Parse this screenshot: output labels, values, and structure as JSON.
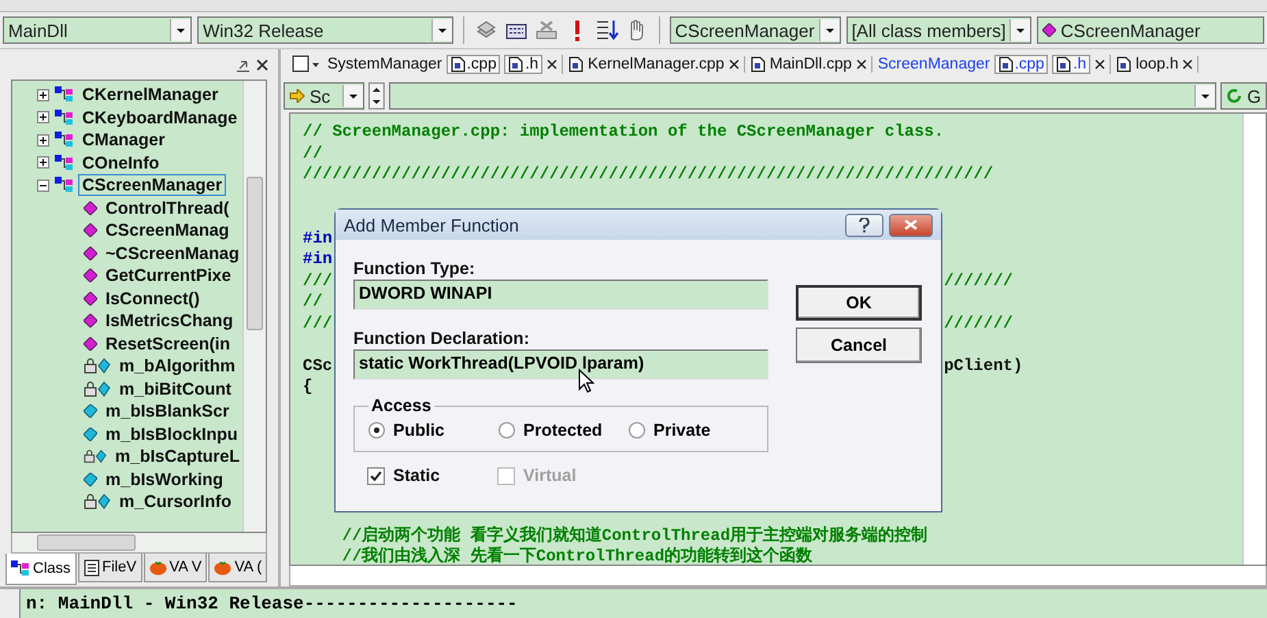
{
  "toolbar": {
    "project": "MainDll",
    "configuration": "Win32 Release",
    "class_combo": "CScreenManager",
    "filter_combo": "[All class members]",
    "member_combo": "CScreenManager"
  },
  "editor_tabs": [
    {
      "label": "SystemManager",
      "files": [
        ".cpp",
        ".h"
      ],
      "selected": false
    },
    {
      "label": "KernelManager.cpp",
      "selected": false
    },
    {
      "label": "MainDll.cpp",
      "selected": false
    },
    {
      "label": "ScreenManager",
      "files": [
        ".cpp",
        ".h"
      ],
      "selected": true
    },
    {
      "label": "loop.h",
      "selected": false
    }
  ],
  "wizard_bar": {
    "scope": "Sc",
    "go": "G"
  },
  "class_tree": [
    {
      "label": "CKernelManager",
      "kind": "class",
      "expanded": false,
      "selected": false
    },
    {
      "label": "CKeyboardManage",
      "kind": "class",
      "expanded": false,
      "selected": false
    },
    {
      "label": "CManager",
      "kind": "class",
      "expanded": false,
      "selected": false
    },
    {
      "label": "COneInfo",
      "kind": "class",
      "expanded": false,
      "selected": false
    },
    {
      "label": "CScreenManager",
      "kind": "class",
      "expanded": true,
      "selected": true,
      "children": [
        {
          "label": "ControlThread(",
          "kind": "method"
        },
        {
          "label": "CScreenManag",
          "kind": "method"
        },
        {
          "label": "~CScreenManag",
          "kind": "method"
        },
        {
          "label": "GetCurrentPixe",
          "kind": "method"
        },
        {
          "label": "IsConnect()",
          "kind": "method"
        },
        {
          "label": "IsMetricsChang",
          "kind": "method"
        },
        {
          "label": "ResetScreen(in",
          "kind": "method"
        },
        {
          "label": "m_bAlgorithm",
          "kind": "private_member"
        },
        {
          "label": "m_biBitCount",
          "kind": "private_member"
        },
        {
          "label": "m_bIsBlankScr",
          "kind": "member"
        },
        {
          "label": "m_bIsBlockInpu",
          "kind": "member"
        },
        {
          "label": "m_bIsCaptureL",
          "kind": "private_member"
        },
        {
          "label": "m_bIsWorking",
          "kind": "member"
        },
        {
          "label": "m_CursorInfo",
          "kind": "private_member"
        }
      ]
    }
  ],
  "workspace_tabs": [
    {
      "label": "Class",
      "selected": true
    },
    {
      "label": "FileV",
      "selected": false
    },
    {
      "label": "VA V",
      "selected": false
    },
    {
      "label": "VA (",
      "selected": false
    }
  ],
  "code_lines": [
    {
      "text": "// ScreenManager.cpp: implementation of the CScreenManager class.",
      "kind": "comment"
    },
    {
      "text": "//",
      "kind": "comment"
    },
    {
      "text": "//////////////////////////////////////////////////////////////////////",
      "kind": "comment"
    },
    {
      "kind": "blank"
    },
    {
      "kind": "blank"
    },
    {
      "text": "#in",
      "kind": "directive"
    },
    {
      "text": "#in",
      "kind": "directive"
    },
    {
      "text": "///",
      "right": "///////",
      "kind": "comment"
    },
    {
      "text": "//",
      "kind": "comment"
    },
    {
      "text": "///",
      "right": "///////",
      "kind": "comment"
    },
    {
      "kind": "blank"
    },
    {
      "text": "CSc",
      "right": "pClient)",
      "kind": "code"
    },
    {
      "text": "{",
      "kind": "code"
    },
    {
      "kind": "blank"
    },
    {
      "kind": "blank"
    },
    {
      "kind": "blank"
    },
    {
      "kind": "blank"
    },
    {
      "kind": "blank"
    },
    {
      "kind": "blank"
    },
    {
      "text": "    //启动两个功能 看字义我们就知道ControlThread用于主控端对服务端的控制",
      "kind": "comment"
    },
    {
      "text": "    //我们由浅入深 先看一下ControlThread的功能转到这个函数",
      "kind": "comment"
    }
  ],
  "output": "n: MainDll - Win32 Release--------------------",
  "dialog": {
    "title": "Add Member Function",
    "function_type_label": "Function Type:",
    "function_type": "DWORD WINAPI",
    "declaration_label": "Function Declaration:",
    "declaration": "static WorkThread(LPVOID lparam)",
    "access_label": "Access",
    "access": [
      {
        "label": "Public",
        "selected": true
      },
      {
        "label": "Protected",
        "selected": false
      },
      {
        "label": "Private",
        "selected": false
      }
    ],
    "options": [
      {
        "label": "Static",
        "checked": true,
        "disabled": false
      },
      {
        "label": "Virtual",
        "checked": false,
        "disabled": true
      }
    ],
    "buttons": [
      "OK",
      "Cancel"
    ]
  }
}
